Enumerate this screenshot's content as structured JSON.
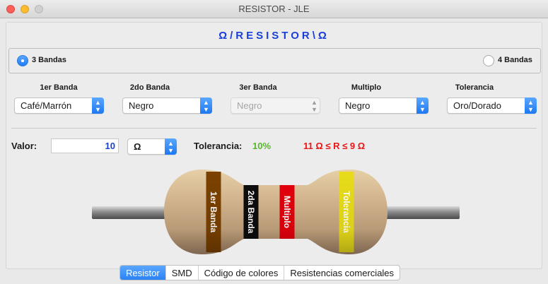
{
  "window": {
    "title": "RESISTOR - JLE"
  },
  "app": {
    "title": "Ω/RESISTOR\\Ω"
  },
  "mode": {
    "options": [
      {
        "label": "3 Bandas",
        "selected": true
      },
      {
        "label": "4 Bandas",
        "selected": false
      }
    ]
  },
  "bands": {
    "columns": [
      {
        "label": "1er Banda",
        "value": "Café/Marrón",
        "enabled": true
      },
      {
        "label": "2do Banda",
        "value": "Negro",
        "enabled": true
      },
      {
        "label": "3er Banda",
        "value": "Negro",
        "enabled": false
      },
      {
        "label": "Multiplo",
        "value": "Negro",
        "enabled": true
      },
      {
        "label": "Tolerancia",
        "value": "Oro/Dorado",
        "enabled": true
      }
    ]
  },
  "result": {
    "valor_label": "Valor:",
    "valor": "10",
    "unit": "Ω",
    "tolerancia_label": "Tolerancia:",
    "tolerancia": "10%",
    "range": "11 Ω ≤ R ≤ 9 Ω"
  },
  "resistor": {
    "bands": [
      {
        "label": "1er Banda",
        "color": "#7a4100"
      },
      {
        "label": "2da Banda",
        "color": "#0d0d0d"
      },
      {
        "label": "Multiplo",
        "color": "#e3000b"
      },
      {
        "label": "Tolerancia",
        "color": "#e8dc1a"
      }
    ]
  },
  "tabs": [
    {
      "label": "Resistor",
      "active": true
    },
    {
      "label": "SMD",
      "active": false
    },
    {
      "label": "Código de colores",
      "active": false
    },
    {
      "label": "Resistencias comerciales",
      "active": false
    }
  ],
  "colors": {
    "accent": "#1f7cf5",
    "title": "#1a3fd6",
    "tolerance": "#55b82a",
    "range": "#e81616"
  }
}
